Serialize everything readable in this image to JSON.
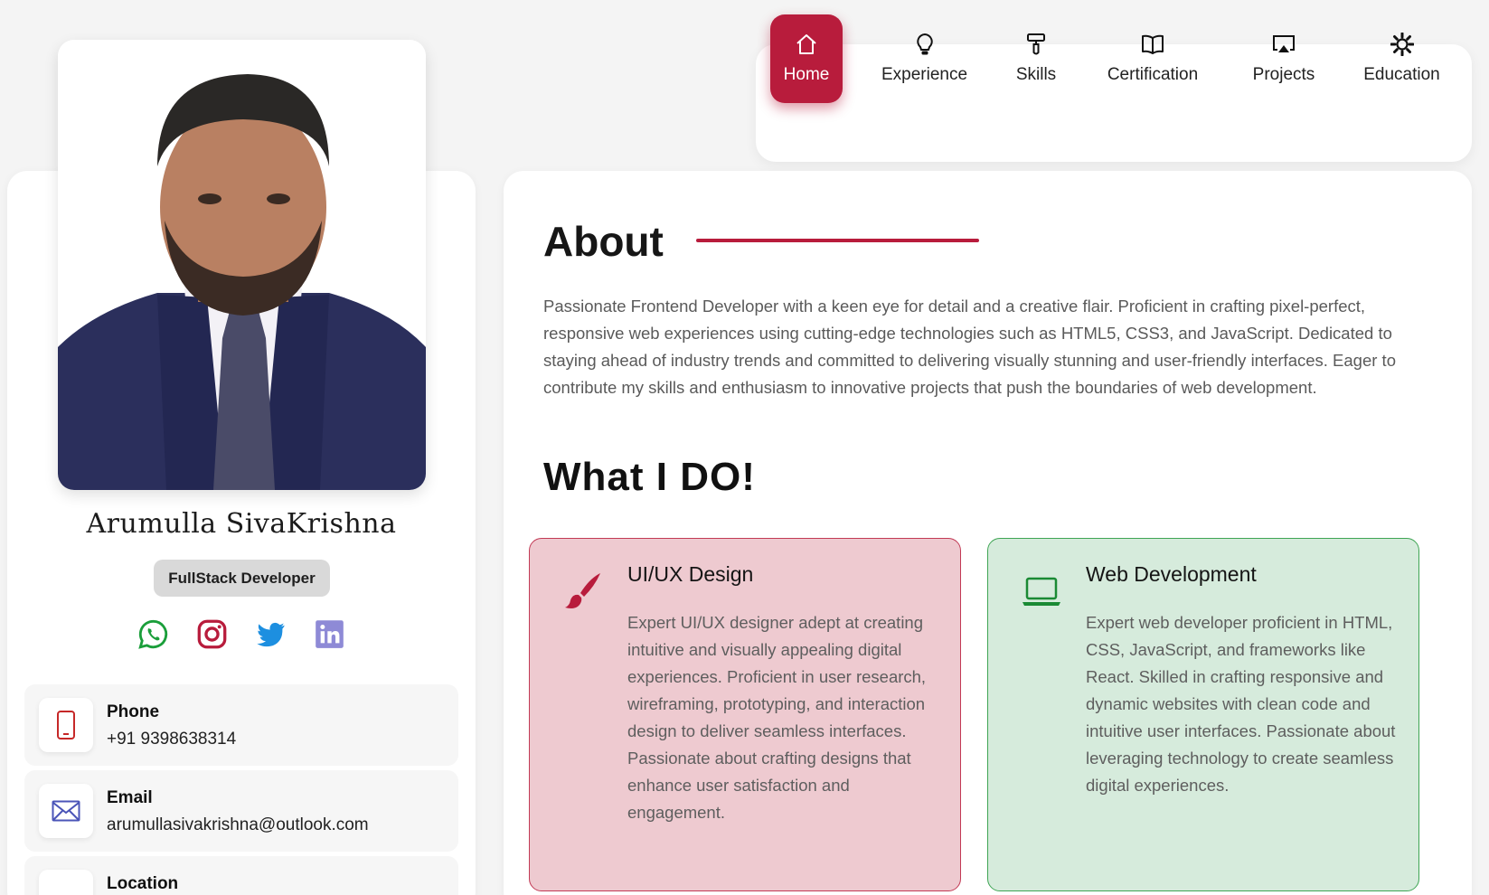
{
  "profile": {
    "name": "Arumulla SivaKrishna",
    "role": "FullStack Developer",
    "socials": [
      {
        "name": "whatsapp",
        "color": "#1a9e3a"
      },
      {
        "name": "instagram",
        "color": "#b81c3c"
      },
      {
        "name": "twitter",
        "color": "#1d8fe0"
      },
      {
        "name": "linkedin",
        "color": "#8e8ad6"
      }
    ],
    "contacts": [
      {
        "label": "Phone",
        "value": "+91 9398638314",
        "icon": "phone-icon",
        "color": "#c62828"
      },
      {
        "label": "Email",
        "value": "arumullasivakrishna@outlook.com",
        "icon": "mail-icon",
        "color": "#4b55b8"
      },
      {
        "label": "Location",
        "value": "",
        "icon": "location-icon",
        "color": "#1a9e3a"
      }
    ]
  },
  "nav": {
    "items": [
      {
        "label": "Home",
        "icon": "home-icon",
        "active": true
      },
      {
        "label": "Experience",
        "icon": "lightbulb-icon",
        "active": false
      },
      {
        "label": "Skills",
        "icon": "paint-roller-icon",
        "active": false
      },
      {
        "label": "Certification",
        "icon": "book-open-icon",
        "active": false
      },
      {
        "label": "Projects",
        "icon": "airplay-icon",
        "active": false
      },
      {
        "label": "Education",
        "icon": "gear-icon",
        "active": false
      }
    ],
    "accent": "#b81c3c"
  },
  "about": {
    "title": "About",
    "text": "Passionate Frontend Developer with a keen eye for detail and a creative flair. Proficient in crafting pixel-perfect, responsive web experiences using cutting-edge technologies such as HTML5, CSS3, and JavaScript. Dedicated to staying ahead of industry trends and committed to delivering visually stunning and user-friendly interfaces. Eager to contribute my skills and enthusiasm to innovative projects that push the boundaries of web development."
  },
  "what_i_do": {
    "title": "What I DO!",
    "services": [
      {
        "title": "UI/UX Design",
        "icon": "paintbrush-icon",
        "text": "Expert UI/UX designer adept at creating intuitive and visually appealing digital experiences. Proficient in user research, wireframing, prototyping, and interaction design to deliver seamless interfaces. Passionate about crafting designs that enhance user satisfaction and engagement.",
        "bg": "#eecad0",
        "border": "#c23a55"
      },
      {
        "title": "Web Development",
        "icon": "laptop-icon",
        "text": "Expert web developer proficient in HTML, CSS, JavaScript, and frameworks like React. Skilled in crafting responsive and dynamic websites with clean code and intuitive user interfaces. Passionate about leveraging technology to create seamless digital experiences.",
        "bg": "#d6ebdc",
        "border": "#3fa554"
      }
    ]
  }
}
